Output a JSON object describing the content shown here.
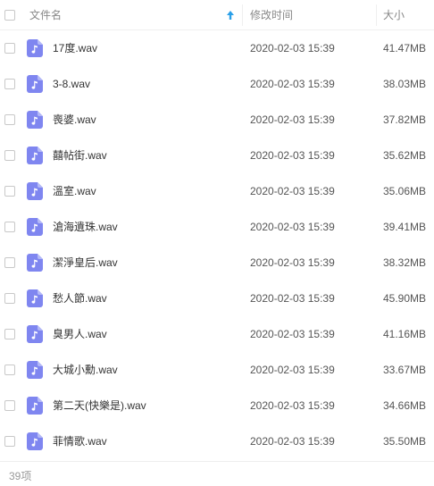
{
  "colors": {
    "accent": "#2a9fe8",
    "file_icon": "#7f86f0"
  },
  "header": {
    "name_label": "文件名",
    "sort_icon": "sort-ascending-arrow-icon",
    "time_label": "修改时间",
    "size_label": "大小"
  },
  "files": [
    {
      "name": "17度.wav",
      "time": "2020-02-03 15:39",
      "size": "41.47MB",
      "icon": "music-note-icon"
    },
    {
      "name": "3-8.wav",
      "time": "2020-02-03 15:39",
      "size": "38.03MB",
      "icon": "music-note-icon"
    },
    {
      "name": "喪婆.wav",
      "time": "2020-02-03 15:39",
      "size": "37.82MB",
      "icon": "music-note-icon"
    },
    {
      "name": "囍帖街.wav",
      "time": "2020-02-03 15:39",
      "size": "35.62MB",
      "icon": "music-note-icon"
    },
    {
      "name": "溫室.wav",
      "time": "2020-02-03 15:39",
      "size": "35.06MB",
      "icon": "music-note-icon"
    },
    {
      "name": "滄海遺珠.wav",
      "time": "2020-02-03 15:39",
      "size": "39.41MB",
      "icon": "music-note-icon"
    },
    {
      "name": "潔淨皇后.wav",
      "time": "2020-02-03 15:39",
      "size": "38.32MB",
      "icon": "music-note-icon"
    },
    {
      "name": "愁人節.wav",
      "time": "2020-02-03 15:39",
      "size": "45.90MB",
      "icon": "music-note-icon"
    },
    {
      "name": "臭男人.wav",
      "time": "2020-02-03 15:39",
      "size": "41.16MB",
      "icon": "music-note-icon"
    },
    {
      "name": "大城小勳.wav",
      "time": "2020-02-03 15:39",
      "size": "33.67MB",
      "icon": "music-note-icon"
    },
    {
      "name": "第二天(快樂是).wav",
      "time": "2020-02-03 15:39",
      "size": "34.66MB",
      "icon": "music-note-icon"
    },
    {
      "name": "菲情歌.wav",
      "time": "2020-02-03 15:39",
      "size": "35.50MB",
      "icon": "music-note-icon"
    }
  ],
  "footer": {
    "count": "39项"
  }
}
